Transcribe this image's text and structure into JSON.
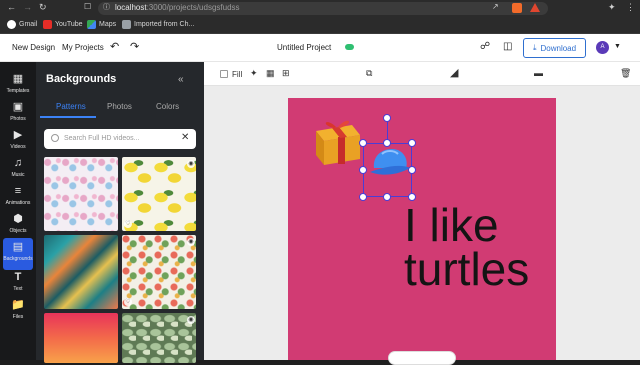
{
  "browser": {
    "url_host": "localhost",
    "url_path": ":3000/projects/udsgsfudss",
    "bookmarks": [
      "Gmail",
      "YouTube",
      "Maps",
      "Imported from Ch..."
    ]
  },
  "appbar": {
    "new_design": "New Design",
    "my_projects": "My Projects",
    "project_title": "Untitled Project",
    "download": "Download",
    "avatar_initial": "A"
  },
  "rail": {
    "items": [
      {
        "label": "Templates",
        "icon": "templates-icon"
      },
      {
        "label": "Photos",
        "icon": "photos-icon"
      },
      {
        "label": "Videos",
        "icon": "videos-icon"
      },
      {
        "label": "Music",
        "icon": "music-icon"
      },
      {
        "label": "Animations",
        "icon": "animations-icon"
      },
      {
        "label": "Objects",
        "icon": "objects-icon"
      },
      {
        "label": "Backgrounds",
        "icon": "backgrounds-icon"
      },
      {
        "label": "Text",
        "icon": "text-icon"
      },
      {
        "label": "Files",
        "icon": "files-icon"
      }
    ],
    "active": "Backgrounds"
  },
  "panel": {
    "title": "Backgrounds",
    "tabs": [
      "Patterns",
      "Photos",
      "Colors"
    ],
    "active_tab": "Patterns",
    "search_placeholder": "Search Full HD videos..."
  },
  "toolbar": {
    "fill_label": "Fill"
  },
  "canvas": {
    "background": "#d13b73",
    "text_line1": "I like",
    "text_line2": "turtles"
  },
  "colors": {
    "accent": "#2f6fcf",
    "selection": "#4a3dd6"
  }
}
